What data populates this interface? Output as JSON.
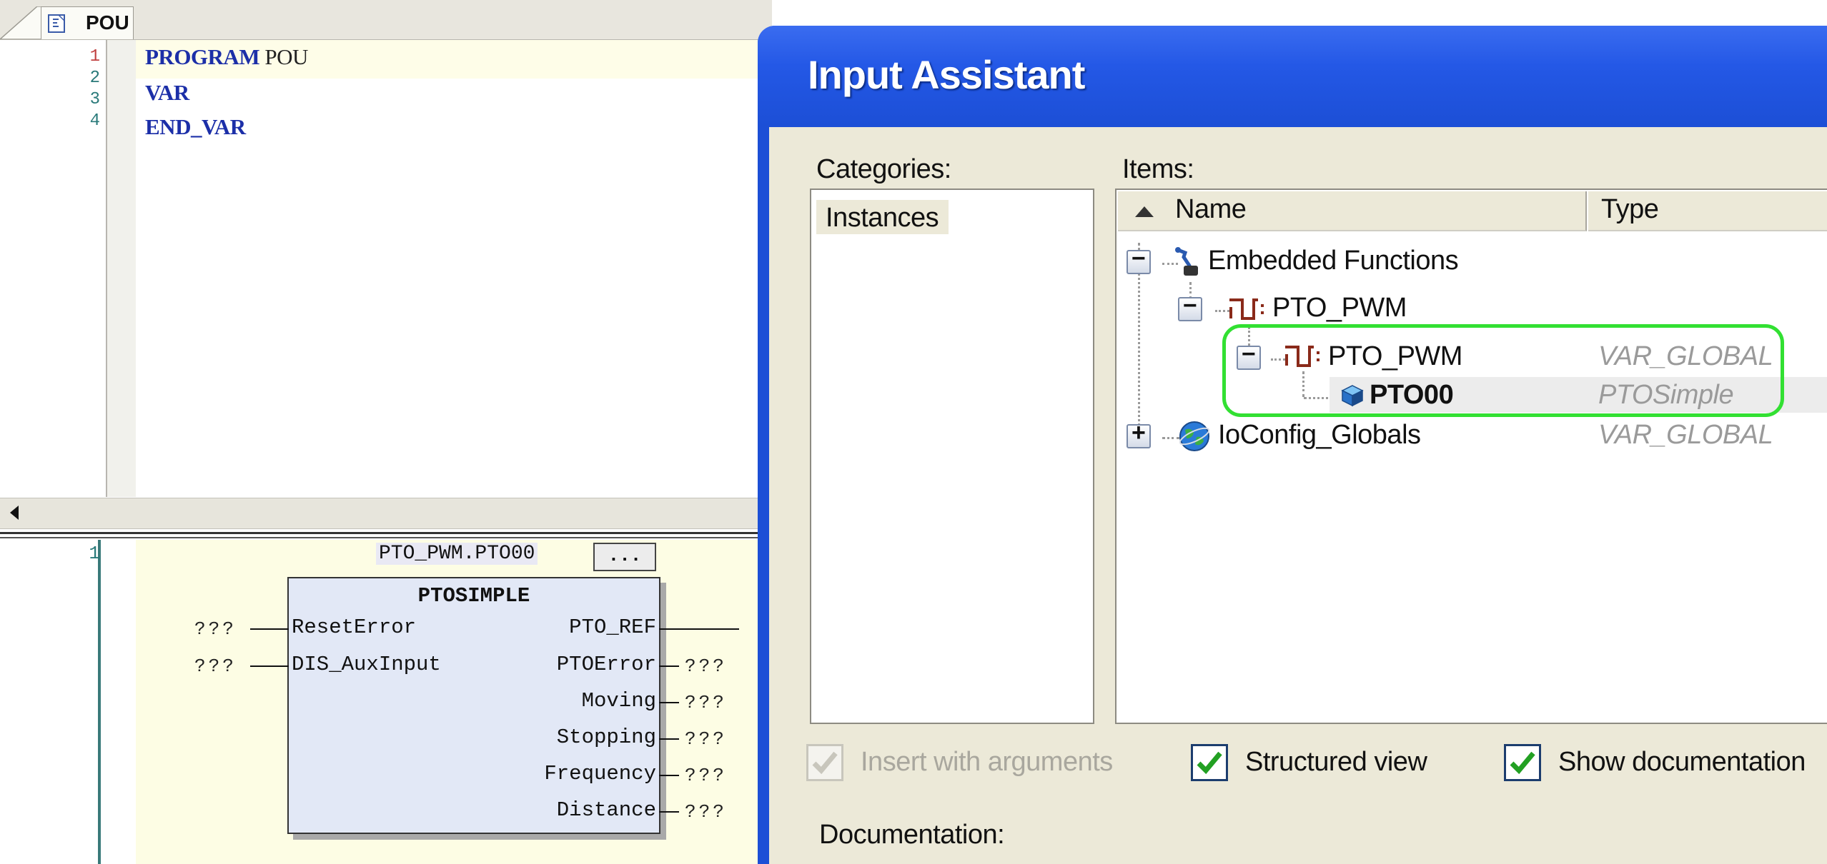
{
  "editor": {
    "tab_label": "POU",
    "declaration": {
      "lines": [
        {
          "num": "1",
          "keyword": "PROGRAM",
          "ident": "POU"
        },
        {
          "num": "2",
          "keyword": "VAR",
          "ident": ""
        },
        {
          "num": "3",
          "keyword": "END_VAR",
          "ident": ""
        },
        {
          "num": "4",
          "keyword": "",
          "ident": ""
        }
      ]
    },
    "fbd": {
      "line_number": "1",
      "instance_name": "PTO_PWM.PTO00",
      "browse_button": "...",
      "block_type": "PTOSIMPLE",
      "inputs": [
        {
          "name": "ResetError",
          "value": "???"
        },
        {
          "name": "DIS_AuxInput",
          "value": "???"
        }
      ],
      "outputs": [
        {
          "name": "PTO_REF",
          "value": ""
        },
        {
          "name": "PTOError",
          "value": "???"
        },
        {
          "name": "Moving",
          "value": "???"
        },
        {
          "name": "Stopping",
          "value": "???"
        },
        {
          "name": "Frequency",
          "value": "???"
        },
        {
          "name": "Distance",
          "value": "???"
        }
      ]
    }
  },
  "dialog": {
    "title": "Input Assistant",
    "categories_label": "Categories:",
    "categories": [
      "Instances"
    ],
    "items_label": "Items:",
    "columns": {
      "name": "Name",
      "type": "Type"
    },
    "tree": [
      {
        "name": "Embedded Functions",
        "type": "",
        "expander": "−"
      },
      {
        "name": "PTO_PWM",
        "type": "",
        "expander": "−"
      },
      {
        "name": "PTO_PWM",
        "type": "VAR_GLOBAL",
        "expander": "−"
      },
      {
        "name": "PTO00",
        "type": "PTOSimple",
        "expander": ""
      },
      {
        "name": "IoConfig_Globals",
        "type": "VAR_GLOBAL",
        "expander": "+"
      }
    ],
    "options": {
      "insert_with_arguments": {
        "label": "Insert with arguments",
        "checked": true,
        "enabled": false
      },
      "structured_view": {
        "label": "Structured view",
        "checked": true,
        "enabled": true
      },
      "show_documentation": {
        "label": "Show documentation",
        "checked": true,
        "enabled": true
      }
    },
    "documentation_label": "Documentation:"
  },
  "colors": {
    "dialog_blue": "#1c4fd6",
    "highlight_green": "#32e032",
    "keyword_blue": "#1c2fa8",
    "check_green": "#22a022"
  }
}
